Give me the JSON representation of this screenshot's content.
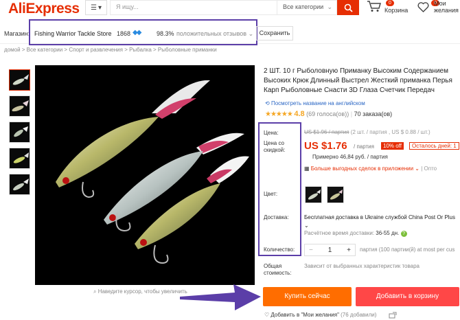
{
  "header": {
    "logo": "AliExpress",
    "search_placeholder": "Я ищу...",
    "category_select": "Все категории",
    "cart_count": "0",
    "cart_label": "Корзина",
    "wishlist_count": "0",
    "wishlist_label_1": "Мои",
    "wishlist_label_2": "желания"
  },
  "store": {
    "shop_label": "Магазин:",
    "name": "Fishing Warrior Tackle Store",
    "score": "1868",
    "positive_pct": "98.3%",
    "positive_label": "положительных отзывов ⌄",
    "save_label": "Сохранить"
  },
  "breadcrumb": "домой > Все категории > Спорт и развлечения > Рыбалка > Рыболовные приманки",
  "gallery": {
    "zoom_hint": "Наведите курсор, чтобы увеличить"
  },
  "product": {
    "title": "2 ШТ. 10 г Рыболовную Приманку Высоким Содержанием Высоких Крюк Длинный Выстрел Жесткий приманка Перья Карп Рыболовные Снасти 3D Глаза Счетчик Передач",
    "translate_link": "Посмотреть название на английском",
    "stars": "★★★★★",
    "rating": "4.8",
    "reviews": "(69 голоса(ов))",
    "orders": "70 заказа(ов)"
  },
  "labels": {
    "price": "Цена:",
    "discount_price_1": "Цена со",
    "discount_price_2": "скидкой:",
    "color": "Цвет:",
    "delivery": "Доставка:",
    "quantity": "Количество:",
    "total_1": "Общая",
    "total_2": "стоимость:"
  },
  "pricing": {
    "old_price": "US $1.96 / партия",
    "old_price_note": "(2 шт. / партия , US $ 0.88 / шт.)",
    "price": "US $1.76",
    "per_lot": "/ партия",
    "discount": "10% off",
    "time_left": "Осталось дней: 1",
    "approx": "Примерно 46,84 руб. / партия",
    "app_deals": "Больше выгодных сделок в приложении ⌄",
    "app_deals_rest": "| Опто"
  },
  "shipping": {
    "text": "Бесплатная доставка в Ukraine службой China Post Or Plus ⌄",
    "time_label": "Расчётное время доставки:",
    "time_value": "36-55 дн.",
    "help": "?"
  },
  "quantity": {
    "minus": "−",
    "value": "1",
    "plus": "+",
    "note": "партия (100 партии(й) at most per cus"
  },
  "total_note": "Зависит от выбранных характеристик товара",
  "actions": {
    "buy_now": "Купить сейчас",
    "add_to_cart": "Добавить в корзину",
    "wishlist": "Добавить в \"Мои желания\"",
    "wishlist_count": "(76 добавили)"
  },
  "colors": {
    "brand": "#e62e04",
    "annotation": "#5b3ea8",
    "buy": "#ff6d00",
    "cart": "#ff4747"
  }
}
